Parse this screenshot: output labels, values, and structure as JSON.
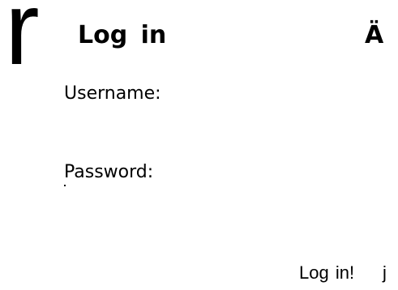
{
  "decor": {
    "large_glyph": "r",
    "corner_glyph": "Ä",
    "trailing_glyph": "j"
  },
  "header": {
    "title": "Log in"
  },
  "form": {
    "username_label": "Username:",
    "password_label": "Password:",
    "username_value": "",
    "password_value": "",
    "submit_label": "Log in!"
  }
}
